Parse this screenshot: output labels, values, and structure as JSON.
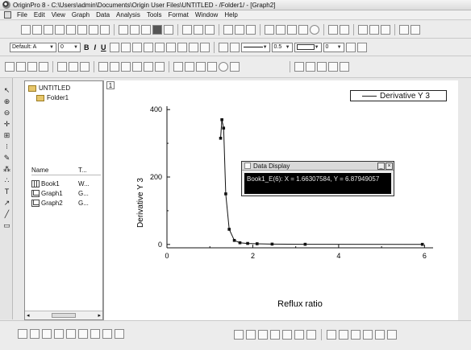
{
  "window": {
    "title": "OriginPro 8 - C:\\Users\\admin\\Documents\\Origin User Files\\UNTITLED - /Folder1/ - [Graph2]"
  },
  "menu": [
    "File",
    "Edit",
    "View",
    "Graph",
    "Data",
    "Analysis",
    "Tools",
    "Format",
    "Window",
    "Help"
  ],
  "format_toolbar": {
    "font_value": "Default: A",
    "size_value": "0",
    "line_width_value": "0.5",
    "pattern_value": "0"
  },
  "project_explorer": {
    "root": "UNTITLED",
    "folder": "Folder1",
    "columns": [
      "Name",
      "T..."
    ],
    "items": [
      {
        "name": "Book1",
        "type": "W..."
      },
      {
        "name": "Graph1",
        "type": "G..."
      },
      {
        "name": "Graph2",
        "type": "G..."
      }
    ]
  },
  "graph": {
    "layer_tab": "1",
    "legend": "Derivative Y 3",
    "xlabel": "Reflux ratio",
    "ylabel": "Derivative Y 3"
  },
  "chart_data": {
    "type": "line",
    "xlabel": "Reflux ratio",
    "ylabel": "Derivative Y 3",
    "xlim": [
      0,
      6.2
    ],
    "ylim": [
      -10,
      410
    ],
    "x_ticks": [
      "0",
      "2",
      "4",
      "6"
    ],
    "y_ticks": [
      "0",
      "200",
      "400"
    ],
    "grid": false,
    "legend_position": "top-right",
    "series": [
      {
        "name": "Derivative Y 3",
        "x": [
          1.25,
          1.28,
          1.32,
          1.37,
          1.45,
          1.57,
          1.7,
          1.88,
          2.1,
          2.45,
          3.22,
          5.95
        ],
        "y": [
          315,
          370,
          345,
          150,
          45,
          12,
          5,
          3,
          2,
          1,
          0.5,
          0.3
        ]
      }
    ]
  },
  "data_display": {
    "title": "Data Display",
    "text": "Book1_E(6): X = 1.66307584, Y = 6.87949057"
  },
  "colors": {
    "plot_line": "#111111",
    "display_bg": "#000000",
    "display_fg": "#e6e6e6"
  }
}
